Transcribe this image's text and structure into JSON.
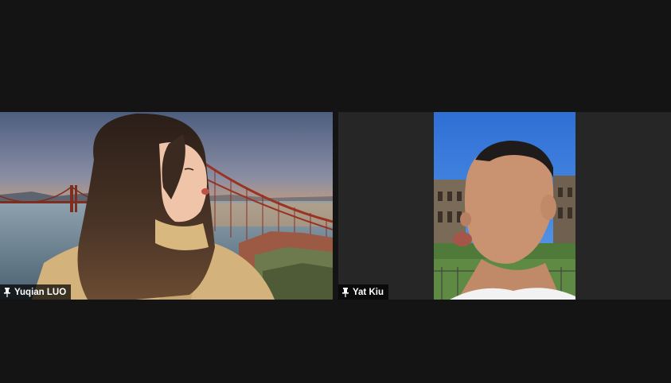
{
  "meeting": {
    "participants": [
      {
        "name": "Yuqian LUO",
        "pinned_icon": "pin-icon",
        "background": "golden-gate-bridge-sunset"
      },
      {
        "name": "Yat Kiu",
        "pinned_icon": "pin-icon",
        "background": "colosseum-blue-sky"
      }
    ]
  },
  "colors": {
    "stage_background": "#141414",
    "tile_background": "#262626",
    "name_tag_text": "#ffffff"
  }
}
